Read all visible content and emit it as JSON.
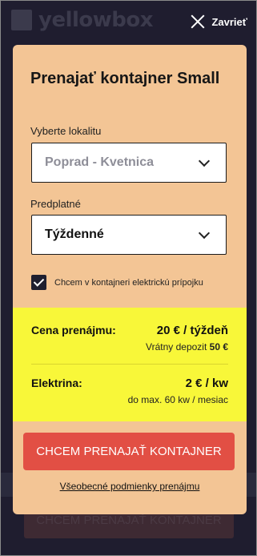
{
  "brand": {
    "name": "yellowbox"
  },
  "close": {
    "label": "Zavrieť"
  },
  "modal": {
    "title": "Prenajať kontajner Small",
    "location": {
      "label": "Vyberte lokalitu",
      "value": "Poprad - Kvetnica"
    },
    "subscription": {
      "label": "Predplatné",
      "value": "Týždenné"
    },
    "electric_checkbox": {
      "label": "Chcem v kontajneri elektrickú prípojku",
      "checked": true
    },
    "pricing": {
      "rent_label": "Cena prenájmu:",
      "rent_price": "20 € / týždeň",
      "deposit_text": "Vrátny depozit",
      "deposit_value": "50 €",
      "electric_label": "Elektrina:",
      "electric_price": "2 € / kw",
      "electric_note": "do max. 60 kw / mesiac"
    },
    "cta_label": "CHCEM PRENAJAŤ KONTAJNER",
    "terms_link": "Všeobecné podmienky prenájmu"
  },
  "background": {
    "cta_label": "CHCEM PRENAJAŤ KONTAJNER"
  },
  "colors": {
    "modal_bg": "#f3c595",
    "highlight": "#f8f739",
    "accent": "#e24f44",
    "overlay": "#1f1d2f"
  }
}
